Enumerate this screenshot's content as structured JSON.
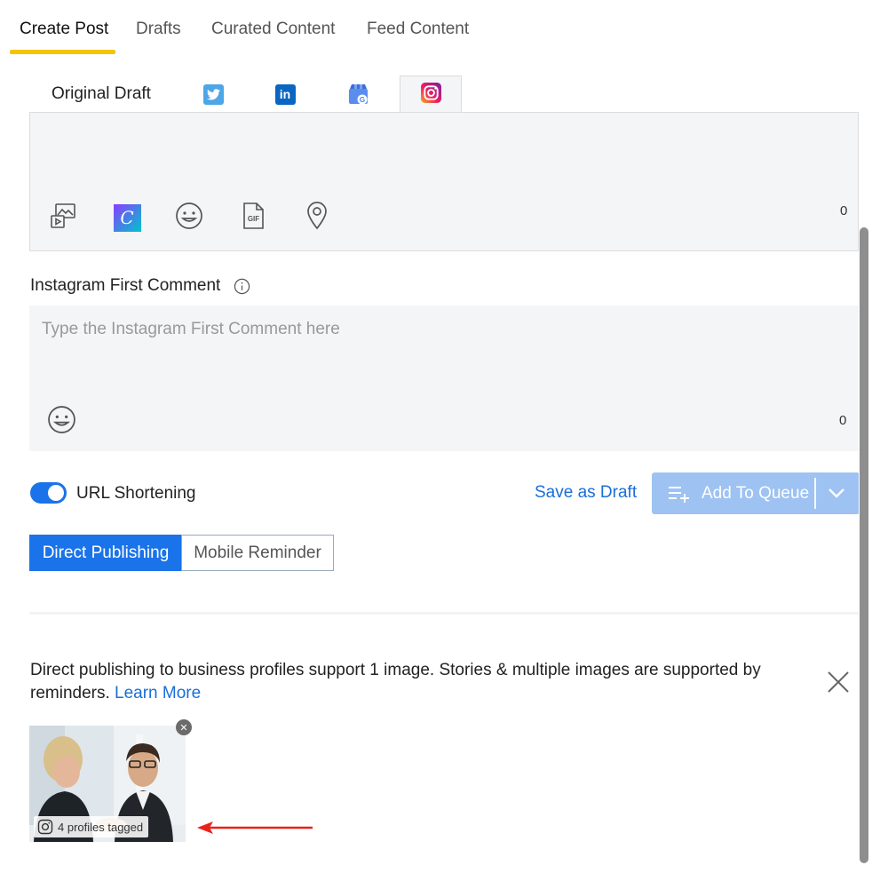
{
  "tabs": [
    {
      "label": "Create Post",
      "active": true
    },
    {
      "label": "Drafts",
      "active": false
    },
    {
      "label": "Curated Content",
      "active": false
    },
    {
      "label": "Feed Content",
      "active": false
    }
  ],
  "network_tabs": {
    "original_label": "Original Draft",
    "items": [
      "twitter-icon",
      "linkedin-icon",
      "google-business-icon",
      "instagram-icon"
    ],
    "selected": "instagram-icon"
  },
  "editor": {
    "char_count": "0",
    "tools": [
      "media-upload-icon",
      "canva-icon",
      "emoji-icon",
      "gif-icon",
      "location-pin-icon"
    ],
    "canva_letter": "C"
  },
  "first_comment": {
    "label": "Instagram First Comment",
    "placeholder": "Type the Instagram First Comment here",
    "char_count": "0"
  },
  "url_shortening": {
    "label": "URL Shortening",
    "enabled": true
  },
  "actions": {
    "save_draft": "Save as Draft",
    "add_to_queue": "Add To Queue"
  },
  "publish_mode": {
    "options": [
      "Direct Publishing",
      "Mobile Reminder"
    ],
    "selected": "Direct Publishing"
  },
  "notice": {
    "text": "Direct publishing to business profiles support 1 image. Stories & multiple images are supported by reminders. ",
    "link": "Learn More"
  },
  "media": {
    "tag_text": "4 profiles tagged",
    "remove_glyph": "✕"
  },
  "colors": {
    "accent": "#1a73e8",
    "tab_underline": "#f5c400",
    "queue_disabled": "#9ec2f2",
    "annotation_arrow": "#e8231a"
  }
}
